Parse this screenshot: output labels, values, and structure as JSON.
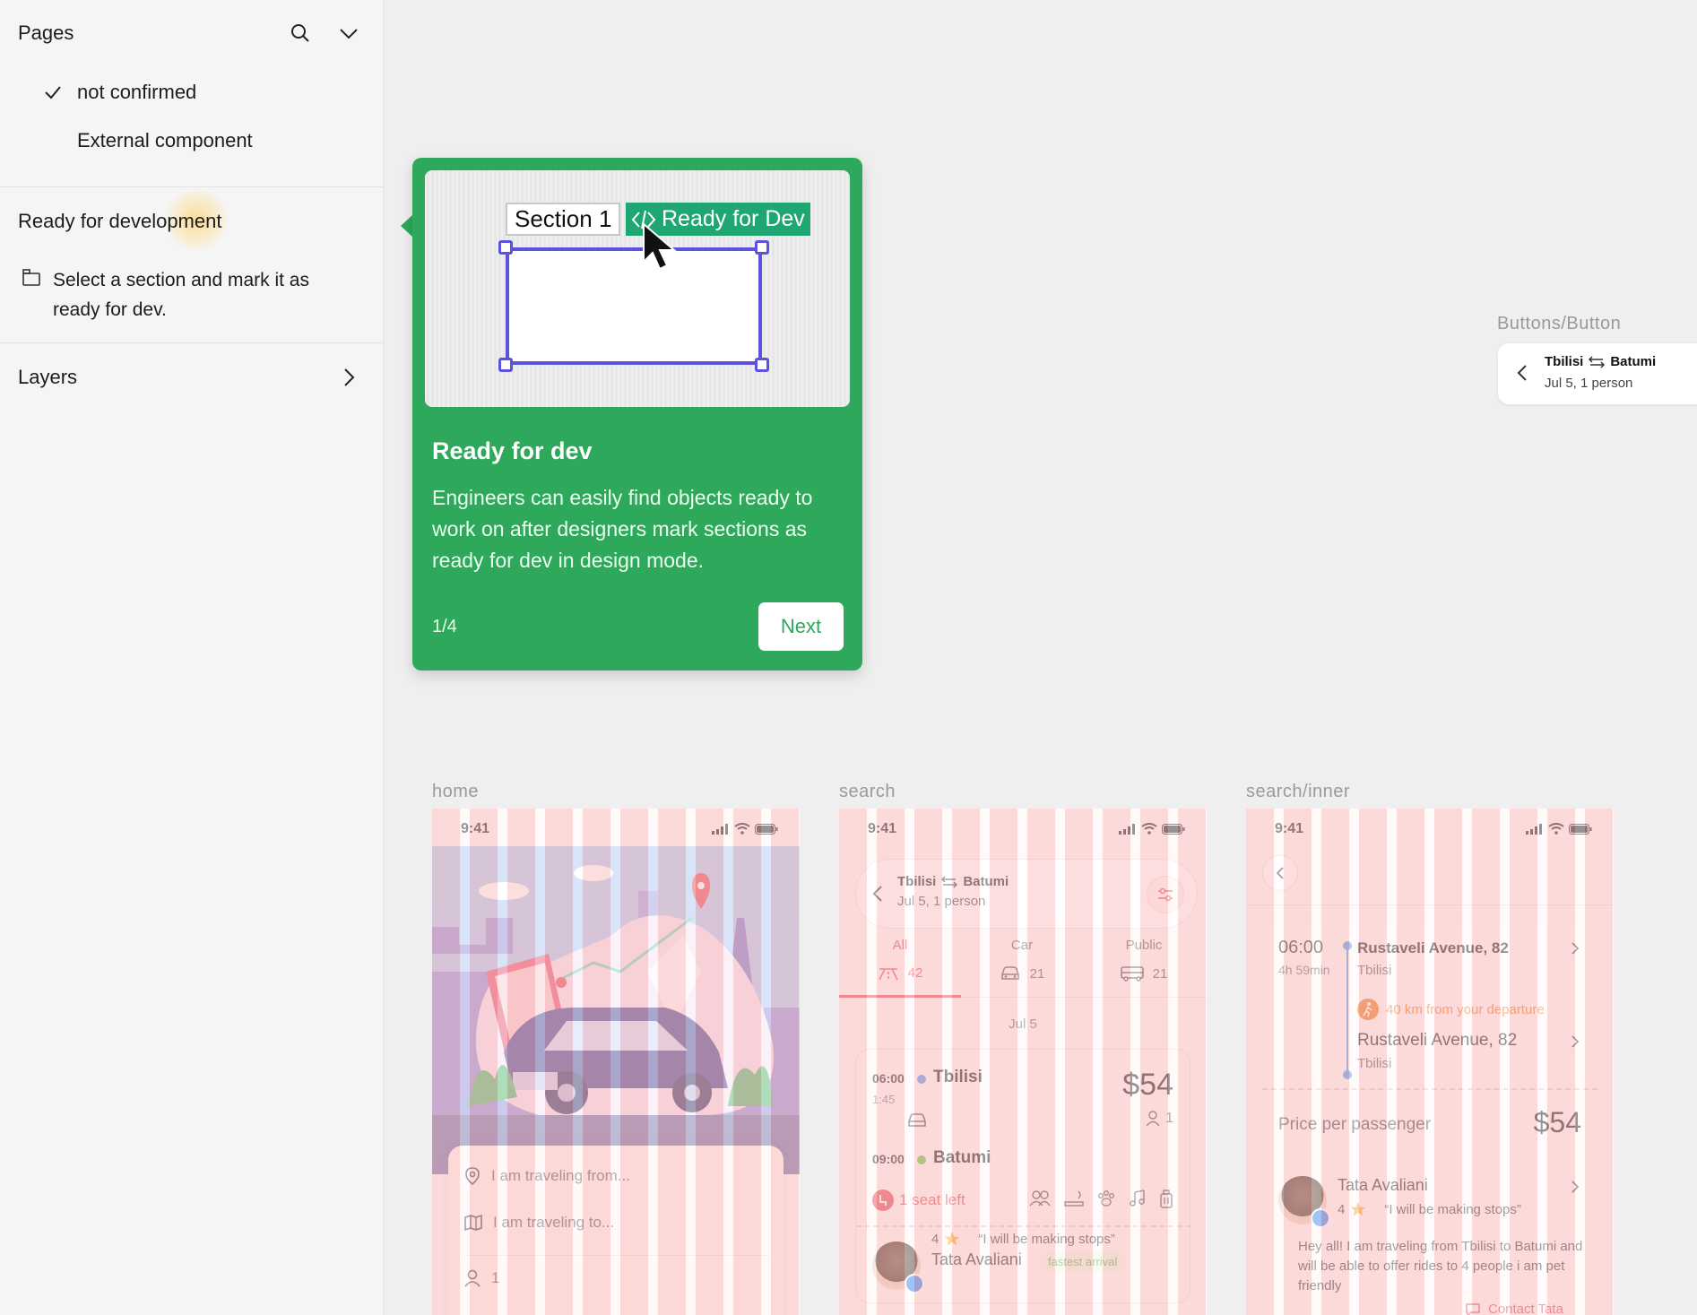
{
  "sidebar": {
    "pages_title": "Pages",
    "pages": [
      {
        "label": "not confirmed",
        "selected": true
      },
      {
        "label": "External component",
        "selected": false
      }
    ],
    "ready_title": "Ready for development",
    "ready_desc": "Select a section and mark it as ready for dev.",
    "layers_title": "Layers"
  },
  "tour": {
    "preview_section_label": "Section 1",
    "preview_badge": "Ready for Dev",
    "title": "Ready for dev",
    "body": "Engineers can easily find objects ready to work on after designers mark sections as ready for dev in design mode.",
    "step": "1/4",
    "next_label": "Next",
    "accent": "#2ea85a"
  },
  "component": {
    "label": "Buttons/Button",
    "from": "Tbilisi",
    "to": "Batumi",
    "sub": "Jul 5, 1 person"
  },
  "frames": {
    "home": {
      "label": "home",
      "time": "9:41",
      "from_placeholder": "I am traveling from...",
      "to_placeholder": "I am traveling to...",
      "passengers": "1"
    },
    "search": {
      "label": "search",
      "time": "9:41",
      "from": "Tbilisi",
      "to": "Batumi",
      "sub": "Jul 5, 1 person",
      "tabs": [
        {
          "label": "All",
          "count": "42",
          "active": true
        },
        {
          "label": "Car",
          "count": "21",
          "active": false
        },
        {
          "label": "Public",
          "count": "21",
          "active": false
        }
      ],
      "date": "Jul 5",
      "trip": {
        "dep_time": "06:00",
        "duration": "1:45",
        "dep_city": "Tbilisi",
        "arr_time": "09:00",
        "arr_city": "Batumi",
        "price": "$54",
        "seats": "1",
        "seat_left": "1 seat left",
        "rating": "4",
        "quote": "“I will be making stops”",
        "driver": "Tata Avaliani",
        "badge": "fastest arrival"
      }
    },
    "inner": {
      "label": "search/inner",
      "time": "9:41",
      "dep_time": "06:00",
      "duration": "4h 59min",
      "dep_place": "Rustaveli Avenue, 82",
      "dep_city": "Tbilisi",
      "walk_note": "40 km from your departure",
      "arr_place": "Rustaveli Avenue, 82",
      "arr_city": "Tbilisi",
      "price_label": "Price per passenger",
      "price": "$54",
      "driver": "Tata Avaliani",
      "rating": "4",
      "quote": "“I will be making stops”",
      "message": "Hey all! I am traveling from Tbilisi to Batumi and will be able to offer rides to 4 people i am pet friendly",
      "contact": "Contact Tata"
    }
  }
}
